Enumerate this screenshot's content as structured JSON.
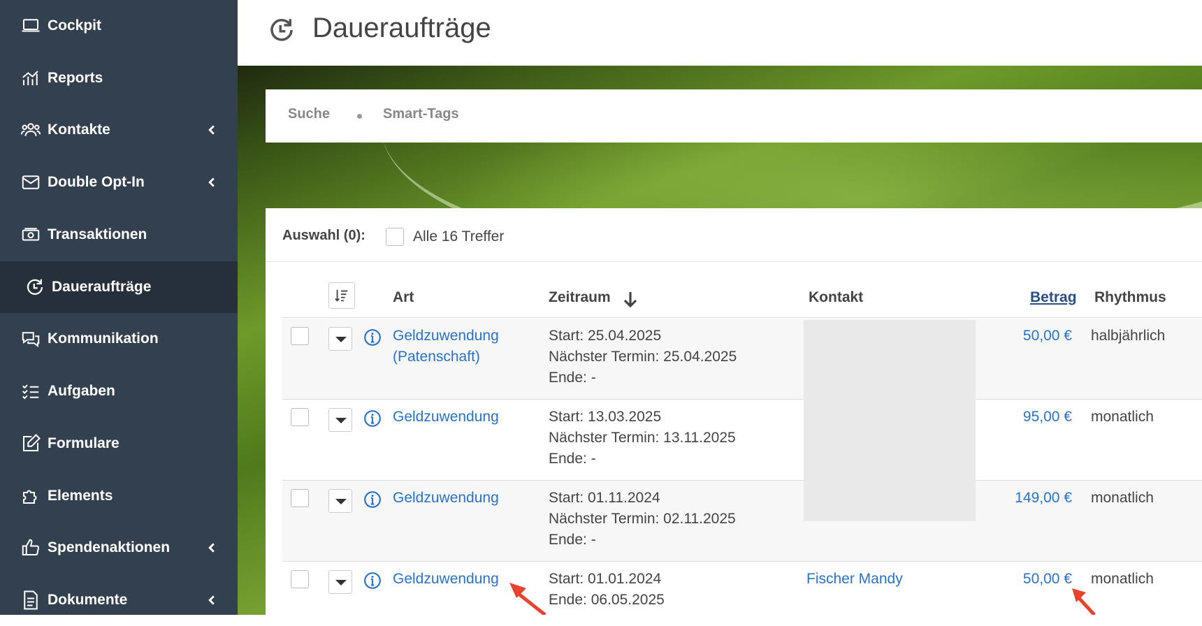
{
  "sidebar": {
    "items": [
      {
        "label": "Cockpit",
        "icon": "laptop-icon",
        "submenu": false,
        "active": false
      },
      {
        "label": "Reports",
        "icon": "chart-icon",
        "submenu": false,
        "active": false
      },
      {
        "label": "Kontakte",
        "icon": "users-icon",
        "submenu": true,
        "active": false
      },
      {
        "label": "Double Opt-In",
        "icon": "envelope-icon",
        "submenu": true,
        "active": false
      },
      {
        "label": "Transaktionen",
        "icon": "money-icon",
        "submenu": false,
        "active": false
      },
      {
        "label": "Daueraufträge",
        "icon": "recurring-clock-icon",
        "submenu": false,
        "active": true
      },
      {
        "label": "Kommunikation",
        "icon": "chat-icon",
        "submenu": false,
        "active": false
      },
      {
        "label": "Aufgaben",
        "icon": "tasks-icon",
        "submenu": false,
        "active": false
      },
      {
        "label": "Formulare",
        "icon": "edit-icon",
        "submenu": false,
        "active": false
      },
      {
        "label": "Elements",
        "icon": "puzzle-icon",
        "submenu": false,
        "active": false
      },
      {
        "label": "Spendenaktionen",
        "icon": "thumbs-up-icon",
        "submenu": true,
        "active": false
      },
      {
        "label": "Dokumente",
        "icon": "document-icon",
        "submenu": true,
        "active": false
      }
    ]
  },
  "header": {
    "title": "Daueraufträge",
    "icon": "recurring-clock-icon"
  },
  "search": {
    "tab_search": "Suche",
    "tab_smart_tags": "Smart-Tags"
  },
  "selection": {
    "label": "Auswahl (0):",
    "select_all": "Alle 16 Treffer"
  },
  "table": {
    "columns": {
      "art": "Art",
      "zeitraum": "Zeitraum",
      "kontakt": "Kontakt",
      "betrag": "Betrag",
      "rhythmus": "Rhythmus"
    },
    "rows": [
      {
        "art": "Geldzuwendung (Patenschaft)",
        "start": "Start: 25.04.2025",
        "next": "Nächster Termin: 25.04.2025",
        "end": "Ende: -",
        "kontakt": "",
        "betrag": "50,00 €",
        "rhythmus": "halbjährlich"
      },
      {
        "art": "Geldzuwendung",
        "start": "Start: 13.03.2025",
        "next": "Nächster Termin: 13.11.2025",
        "end": "Ende: -",
        "kontakt": "",
        "betrag": "95,00 €",
        "rhythmus": "monatlich"
      },
      {
        "art": "Geldzuwendung",
        "start": "Start: 01.11.2024",
        "next": "Nächster Termin: 02.11.2025",
        "end": "Ende: -",
        "kontakt": "",
        "betrag": "149,00 €",
        "rhythmus": "monatlich"
      },
      {
        "art": "Geldzuwendung",
        "start": "Start: 01.01.2024",
        "next": "Ende: 06.05.2025",
        "end": "",
        "kontakt": "Fischer Mandy",
        "betrag": "50,00 €",
        "rhythmus": "monatlich"
      }
    ]
  },
  "colors": {
    "sidebar": "#33404f",
    "sidebar_active": "#26303c",
    "link": "#2a72c8",
    "annotation_arrow": "#e8432c"
  }
}
